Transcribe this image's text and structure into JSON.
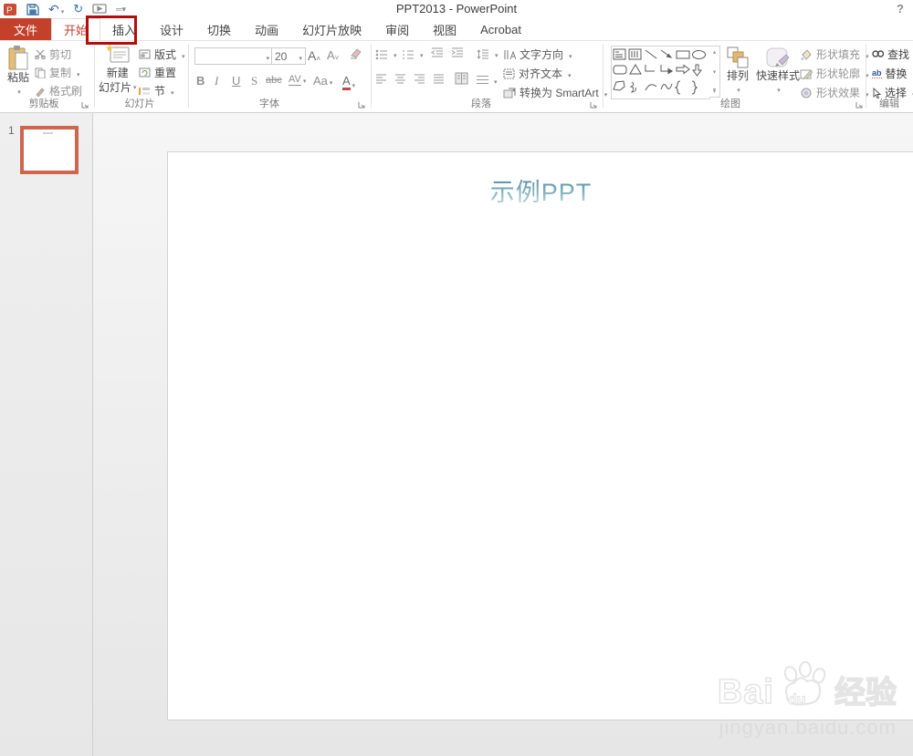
{
  "titlebar": {
    "title": "PPT2013 - PowerPoint",
    "help": "?"
  },
  "tabs": {
    "file": "文件",
    "home": "开始",
    "insert": "插入",
    "design": "设计",
    "transitions": "切换",
    "animations": "动画",
    "slideshow": "幻灯片放映",
    "review": "审阅",
    "view": "视图",
    "acrobat": "Acrobat"
  },
  "clipboard": {
    "label": "剪贴板",
    "paste": "粘贴",
    "cut": "剪切",
    "copy": "复制",
    "format_painter": "格式刷"
  },
  "slides": {
    "label": "幻灯片",
    "new_slide_1": "新建",
    "new_slide_2": "幻灯片",
    "layout": "版式",
    "reset": "重置",
    "section": "节"
  },
  "font": {
    "label": "字体",
    "size": "20",
    "bold": "B",
    "italic": "I",
    "underline": "U",
    "strike": "S",
    "strike2": "abc",
    "spacing": "AV",
    "case": "Aa",
    "color": "A",
    "grow": "A",
    "shrink": "A"
  },
  "paragraph": {
    "label": "段落",
    "text_direction": "文字方向",
    "align_text": "对齐文本",
    "smartart": "转换为 SmartArt"
  },
  "drawing": {
    "label": "绘图",
    "arrange": "排列",
    "quick_styles": "快速样式",
    "shape_fill": "形状填充",
    "shape_outline": "形状轮廓",
    "shape_effects": "形状效果",
    "brace_left": "{",
    "brace_right": "}"
  },
  "editing": {
    "label": "编辑",
    "find": "查找",
    "replace": "替换",
    "select": "选择",
    "replace_icon": "ab"
  },
  "panel": {
    "slide_number": "1"
  },
  "slide": {
    "title": "示例PPT"
  },
  "watermark": {
    "bai": "Bai",
    "du": "du",
    "jingyan": "经验",
    "url": "jingyan.baidu.com"
  },
  "colors": {
    "accent_red": "#c3402b",
    "annotation_red": "#b50d0d",
    "selection_orange": "#d0654e",
    "title_teal": "#5f99a8"
  }
}
